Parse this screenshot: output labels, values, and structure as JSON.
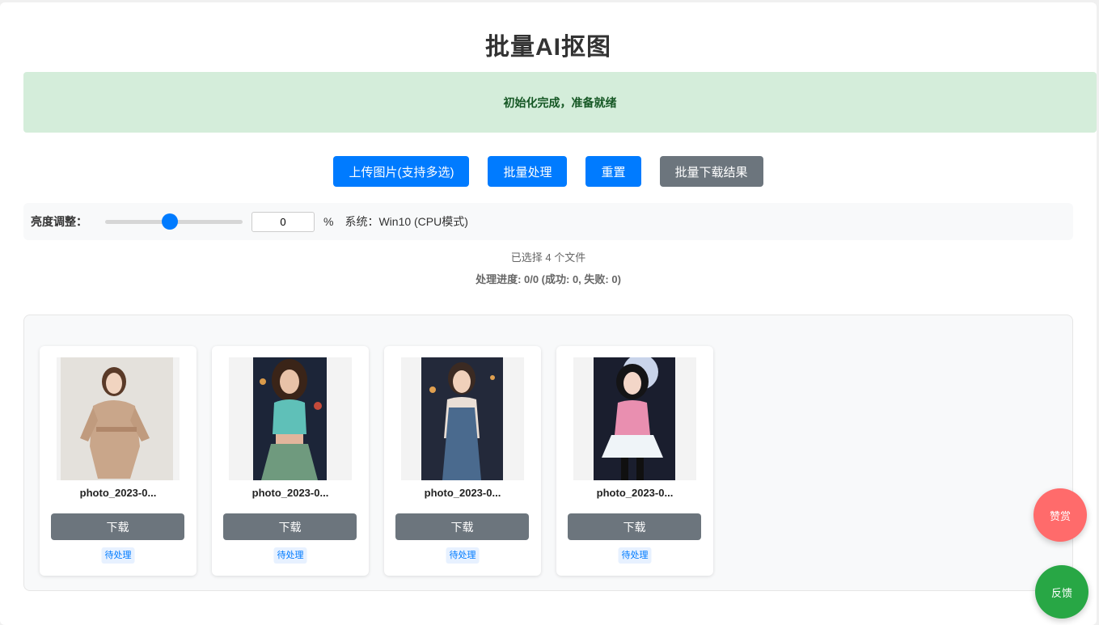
{
  "header": {
    "title": "批量AI抠图"
  },
  "status": {
    "message": "初始化完成，准备就绪"
  },
  "toolbar": {
    "upload_label": "上传图片(支持多选)",
    "batch_label": "批量处理",
    "reset_label": "重置",
    "download_all_label": "批量下载结果"
  },
  "controls": {
    "brightness_label": "亮度调整：",
    "brightness_value": "0",
    "brightness_level": 0.5,
    "percent_unit": "%",
    "system_info": "系统：Win10 (CPU模式)"
  },
  "summary": {
    "file_count": "已选择 4 个文件",
    "progress": "处理进度: 0/0 (成功: 0, 失败: 0)"
  },
  "files": [
    {
      "name": "photo_2023-0...",
      "download_label": "下载",
      "status": "待处理"
    },
    {
      "name": "photo_2023-0...",
      "download_label": "下载",
      "status": "待处理"
    },
    {
      "name": "photo_2023-0...",
      "download_label": "下载",
      "status": "待处理"
    },
    {
      "name": "photo_2023-0...",
      "download_label": "下载",
      "status": "待处理"
    }
  ],
  "floating": {
    "reward_label": "赞赏",
    "feedback_label": "反馈"
  },
  "colors": {
    "primary": "#007bff",
    "secondary": "#6c757d",
    "success_bg": "#d4edda",
    "success_text": "#155724",
    "reward": "#ff6b6b",
    "feedback": "#28a745"
  }
}
